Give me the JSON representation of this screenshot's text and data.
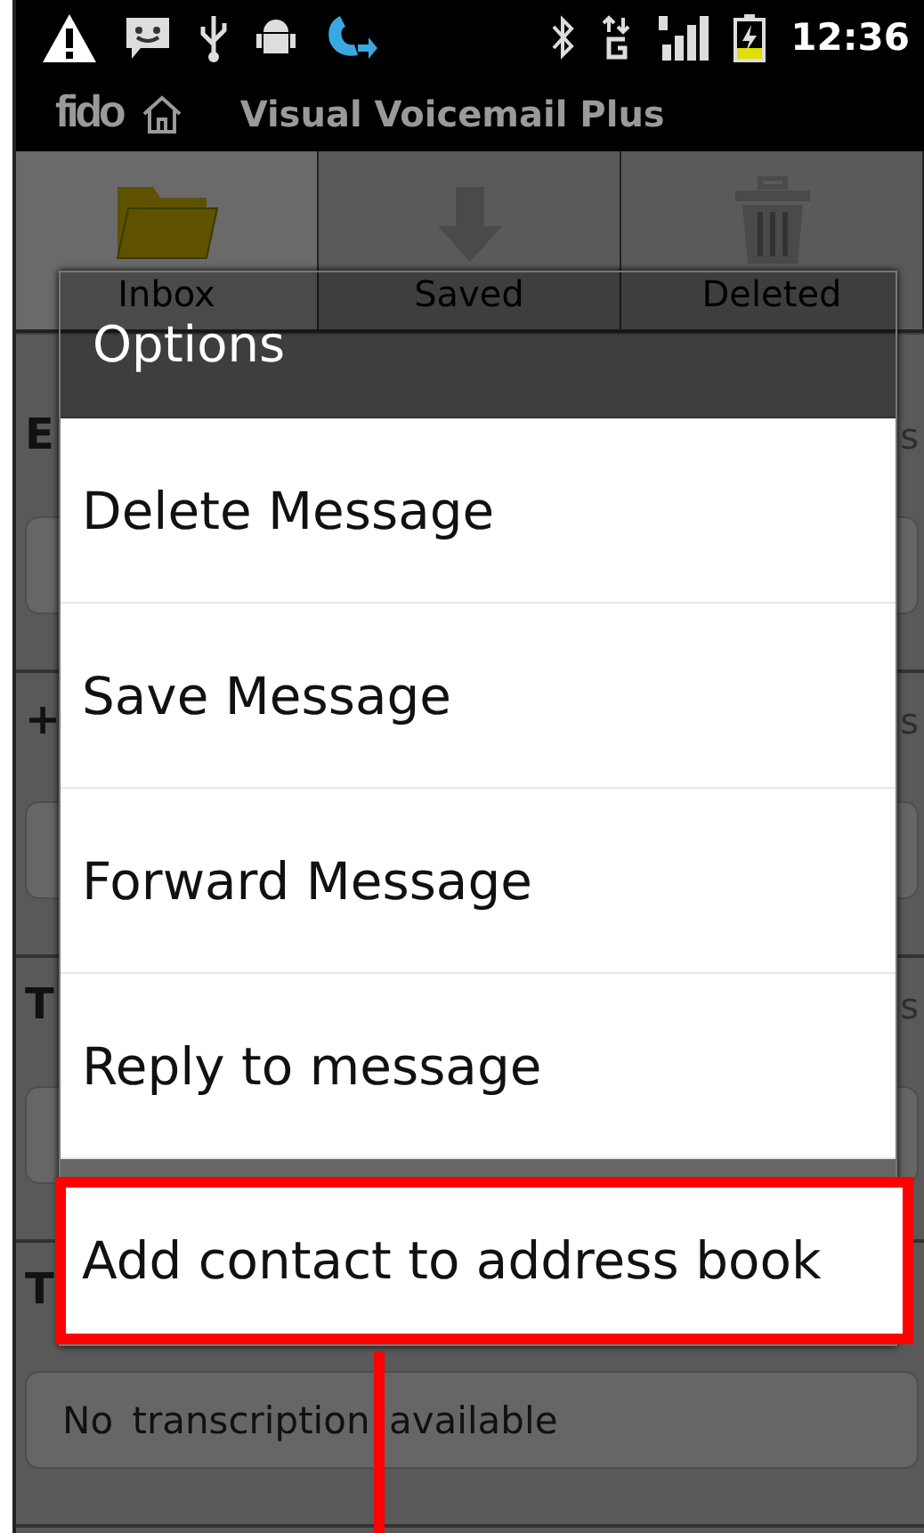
{
  "status_bar": {
    "time": "12:36"
  },
  "app_bar": {
    "logo": "fido",
    "title": "Visual Voicemail Plus"
  },
  "tabs": [
    {
      "label": "Inbox",
      "selected": true
    },
    {
      "label": "Saved",
      "selected": false
    },
    {
      "label": "Deleted",
      "selected": false
    }
  ],
  "messages": [
    {
      "title": "E",
      "meta": "s"
    },
    {
      "title": "+",
      "meta": "s"
    },
    {
      "title": "T",
      "meta": "s"
    },
    {
      "title": "T",
      "transcription": "No transcription available"
    }
  ],
  "dialog": {
    "title": "Options",
    "items": [
      {
        "label": "Delete Message",
        "highlighted": false
      },
      {
        "label": "Save Message",
        "highlighted": false
      },
      {
        "label": "Forward Message",
        "highlighted": false
      },
      {
        "label": "Reply to message",
        "highlighted": false
      },
      {
        "label": "Add contact to address book",
        "highlighted": true
      }
    ]
  }
}
